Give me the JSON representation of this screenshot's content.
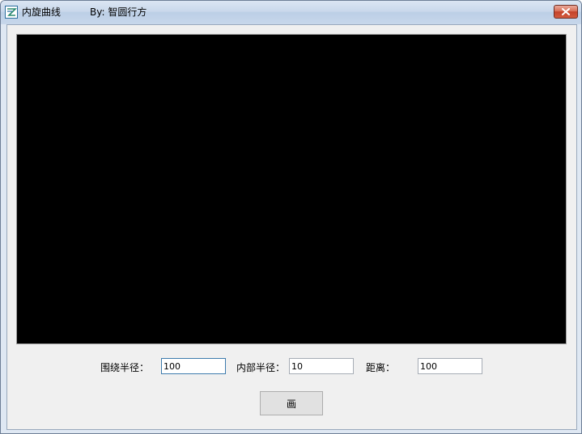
{
  "window": {
    "title": "内旋曲线",
    "author": "By: 智圆行方",
    "close_glyph": "✕"
  },
  "form": {
    "outer_radius_label": "围绕半径：",
    "outer_radius_value": "100",
    "inner_radius_label": "内部半径：",
    "inner_radius_value": "10",
    "distance_label": "距离：",
    "distance_value": "100"
  },
  "draw_button_label": "画",
  "colors": {
    "canvas": "#000000",
    "close_button": "#c7452c",
    "client_background": "#f0f0f0"
  }
}
